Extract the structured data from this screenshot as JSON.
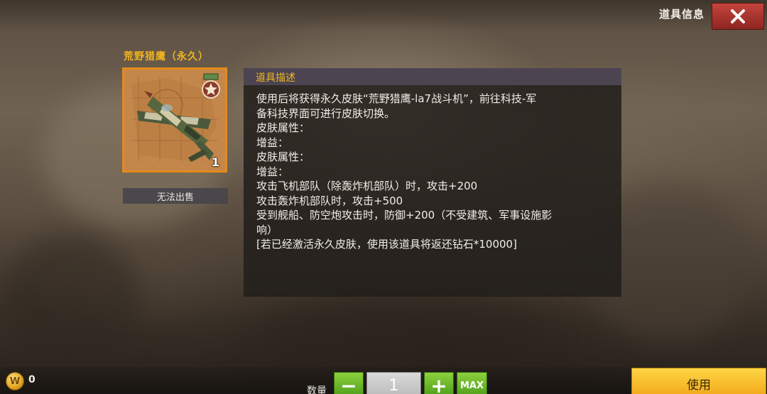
{
  "header": {
    "title": "道具信息"
  },
  "item": {
    "name": "荒野猎鹰（永久）",
    "count": "1",
    "sell_status": "无法出售"
  },
  "description": {
    "title": "道具描述",
    "lines": [
      "使用后将获得永久皮肤“荒野猎鹰-la7战斗机”，前往科技-军",
      "备科技界面可进行皮肤切换。",
      "皮肤属性：",
      "增益：",
      "皮肤属性：",
      "增益：",
      "攻击飞机部队（除轰炸机部队）时，攻击+200",
      "攻击轰炸机部队时，攻击+500",
      "受到舰船、防空炮攻击时，防御+200（不受建筑、军事设施影",
      "响）",
      "[若已经激活永久皮肤，使用该道具将返还钻石*10000]"
    ]
  },
  "footer": {
    "coin_amount": "0",
    "quantity_label": "数量",
    "quantity_value": "1",
    "minus_label": "−",
    "plus_label": "+",
    "max_label": "MAX",
    "use_label": "使用"
  },
  "colors": {
    "item_name": "#f3b51f",
    "close_button": "#c5443d",
    "qty_buttons": "#6ab82a",
    "use_button": "#f8c22e",
    "item_frame": "#e58a1c"
  },
  "icons": {
    "close": "close-icon",
    "coin": "gold-coin-icon",
    "item": "fighter-plane-icon",
    "badge": "star-badge-icon"
  }
}
